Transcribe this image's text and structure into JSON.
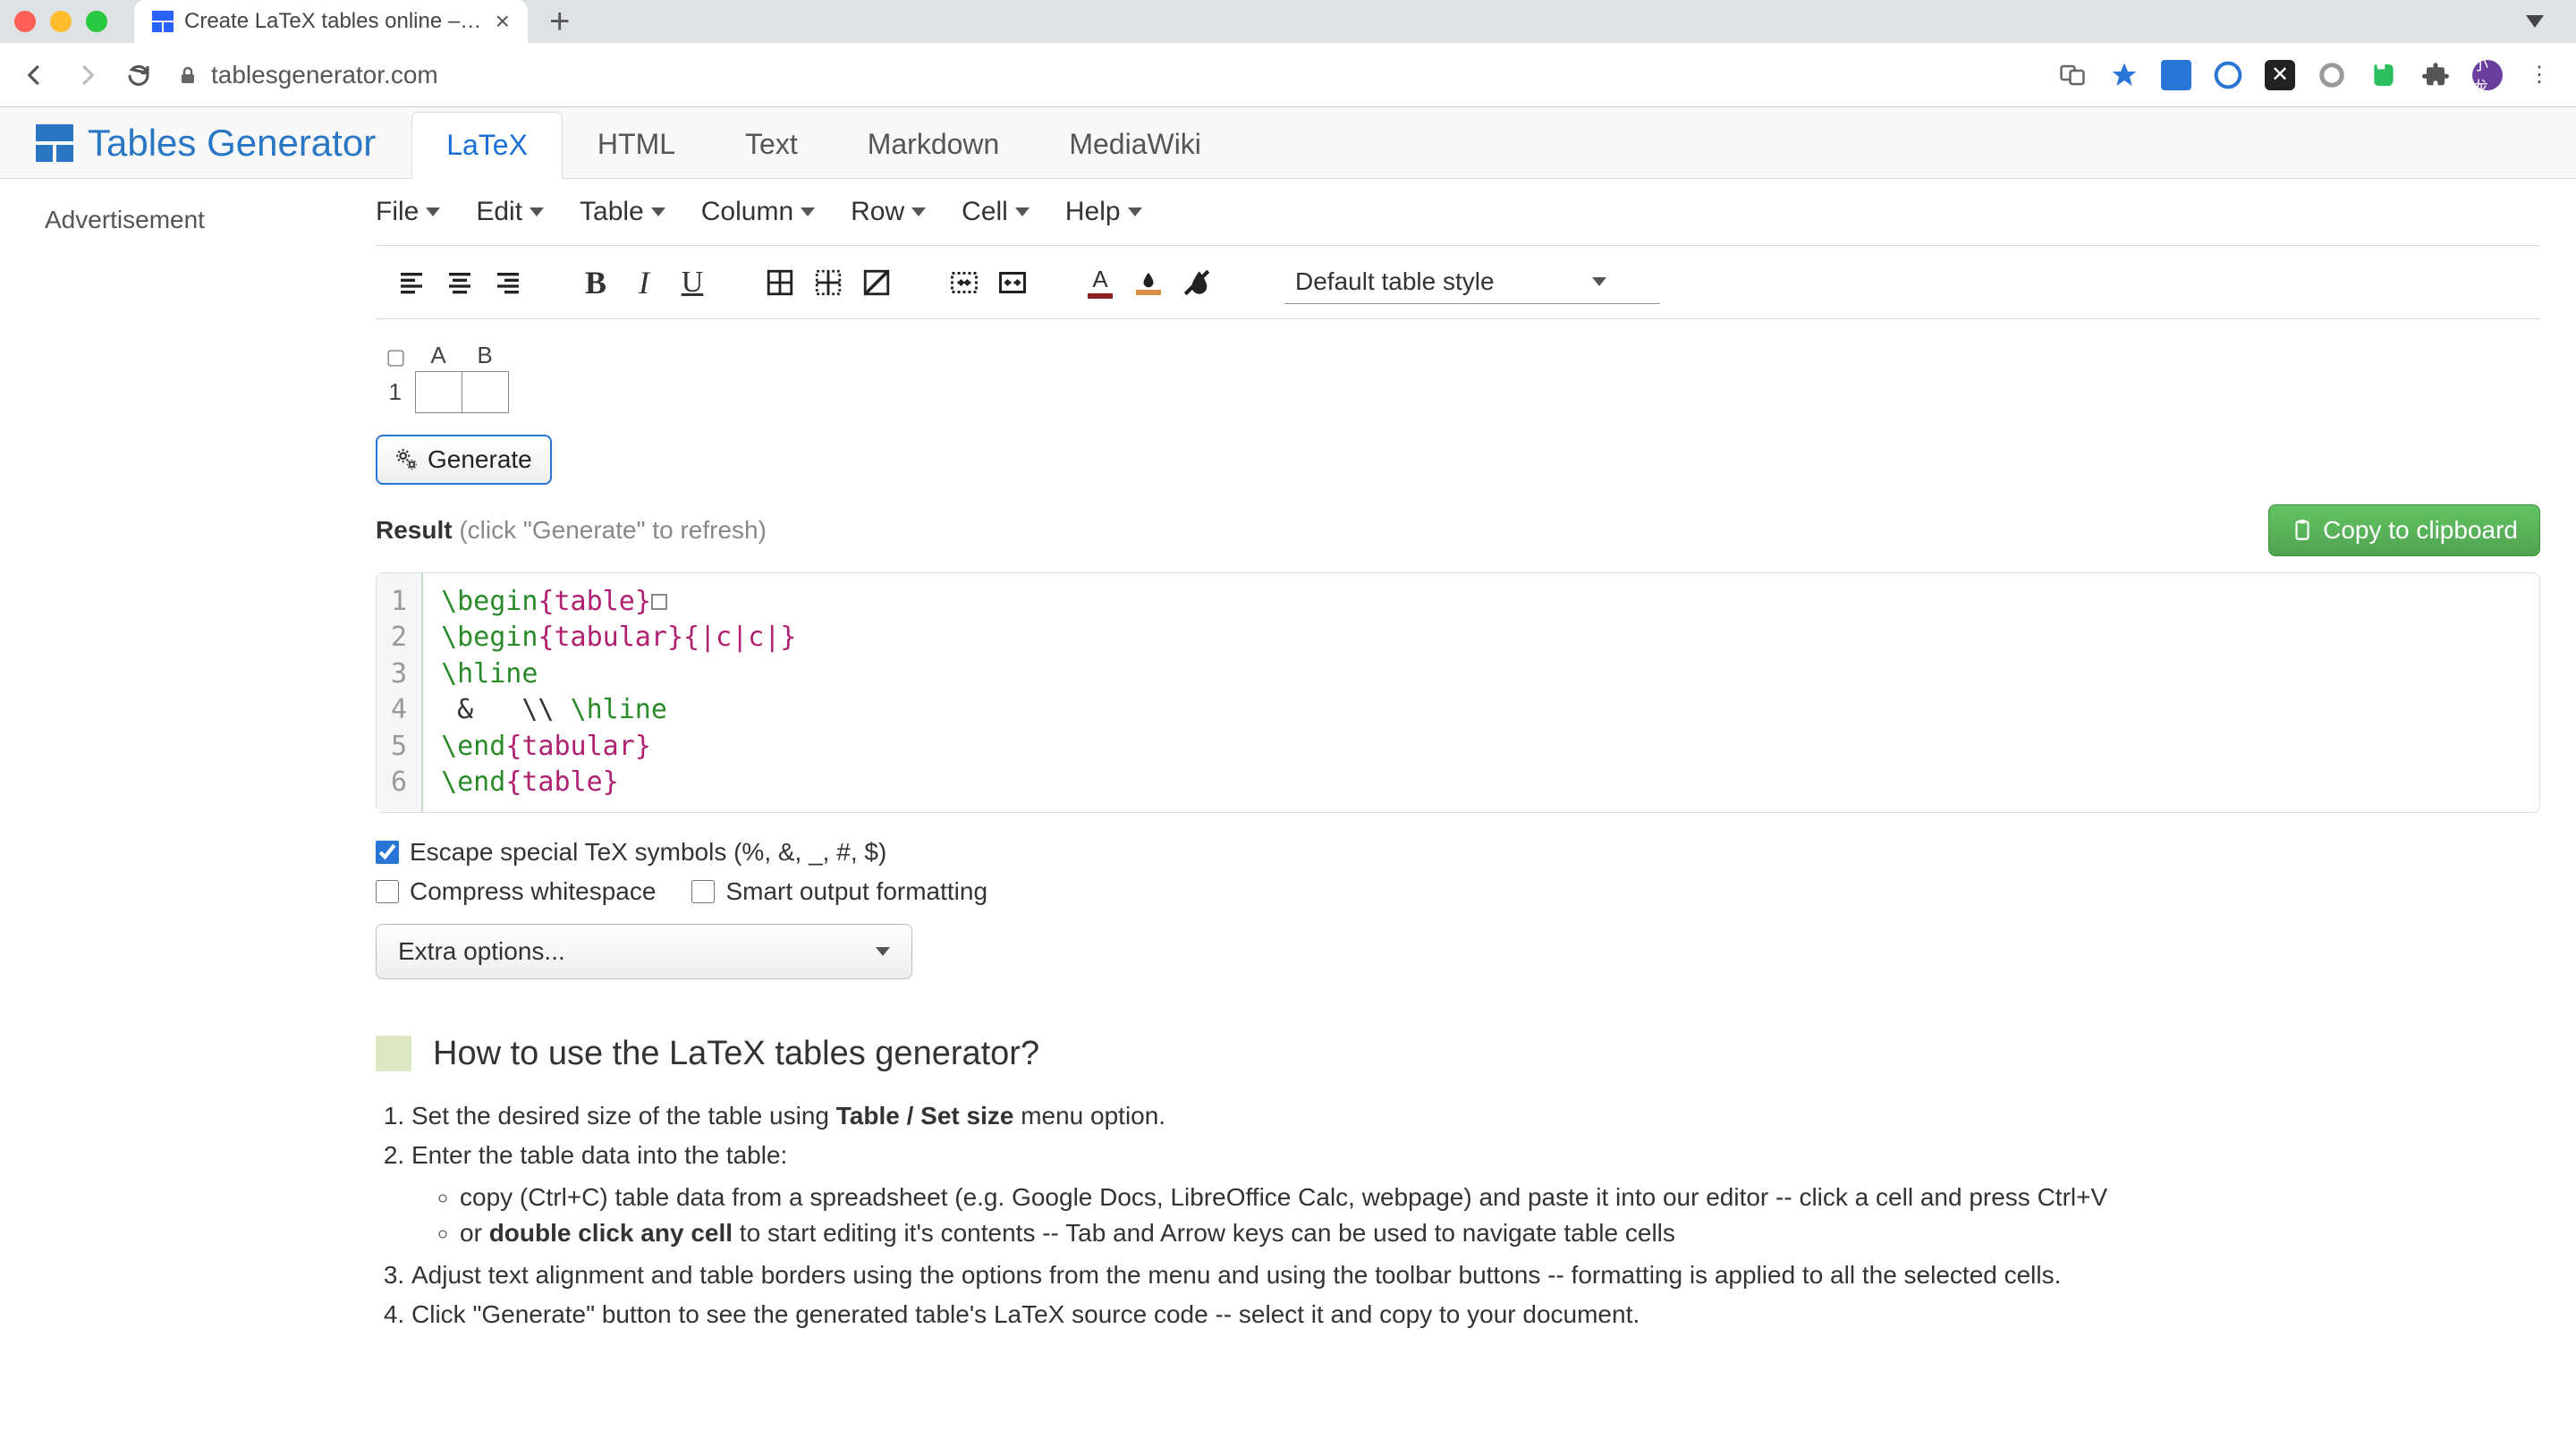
{
  "browser": {
    "tab_title": "Create LaTeX tables online – Ta",
    "url": "tablesgenerator.com"
  },
  "header": {
    "logo_text": "Tables Generator",
    "tabs": [
      "LaTeX",
      "HTML",
      "Text",
      "Markdown",
      "MediaWiki"
    ],
    "active_tab": 0
  },
  "sidebar": {
    "ad_label": "Advertisement"
  },
  "menubar": [
    "File",
    "Edit",
    "Table",
    "Column",
    "Row",
    "Cell",
    "Help"
  ],
  "toolbar": {
    "style_select": "Default table style"
  },
  "editor": {
    "columns": [
      "A",
      "B"
    ],
    "rows": [
      "1"
    ]
  },
  "generate": {
    "button": "Generate"
  },
  "result": {
    "label": "Result",
    "hint": "(click \"Generate\" to refresh)",
    "copy_button": "Copy to clipboard"
  },
  "code": {
    "line_numbers": [
      "1",
      "2",
      "3",
      "4",
      "5",
      "6"
    ],
    "l1": {
      "a": "\\begin",
      "b": "{",
      "c": "table",
      "d": "}"
    },
    "l2": {
      "a": "\\begin",
      "b": "{",
      "c": "tabular",
      "d": "}{",
      "e": "|c|c|",
      "f": "}"
    },
    "l3": {
      "a": "\\hline"
    },
    "l4": {
      "a": " &   \\\\ ",
      "b": "\\hline"
    },
    "l5": {
      "a": "\\end",
      "b": "{",
      "c": "tabular",
      "d": "}"
    },
    "l6": {
      "a": "\\end",
      "b": "{",
      "c": "table",
      "d": "}"
    }
  },
  "options": {
    "escape": "Escape special TeX symbols (%, &, _, #, $)",
    "compress": "Compress whitespace",
    "smart": "Smart output formatting",
    "extra": "Extra options...",
    "escape_checked": true,
    "compress_checked": false,
    "smart_checked": false
  },
  "howto": {
    "title": "How to use the LaTeX tables generator?",
    "step1_a": "Set the desired size of the table using ",
    "step1_b": "Table / Set size",
    "step1_c": " menu option.",
    "step2": "Enter the table data into the table:",
    "step2_sub1": "copy (Ctrl+C) table data from a spreadsheet (e.g. Google Docs, LibreOffice Calc, webpage) and paste it into our editor -- click a cell and press Ctrl+V",
    "step2_sub2_a": "or ",
    "step2_sub2_b": "double click any cell",
    "step2_sub2_c": " to start editing it's contents -- Tab and Arrow keys can be used to navigate table cells",
    "step3": "Adjust text alignment and table borders using the options from the menu and using the toolbar buttons -- formatting is applied to all the selected cells.",
    "step4": "Click \"Generate\" button to see the generated table's LaTeX source code -- select it and copy to your document."
  }
}
